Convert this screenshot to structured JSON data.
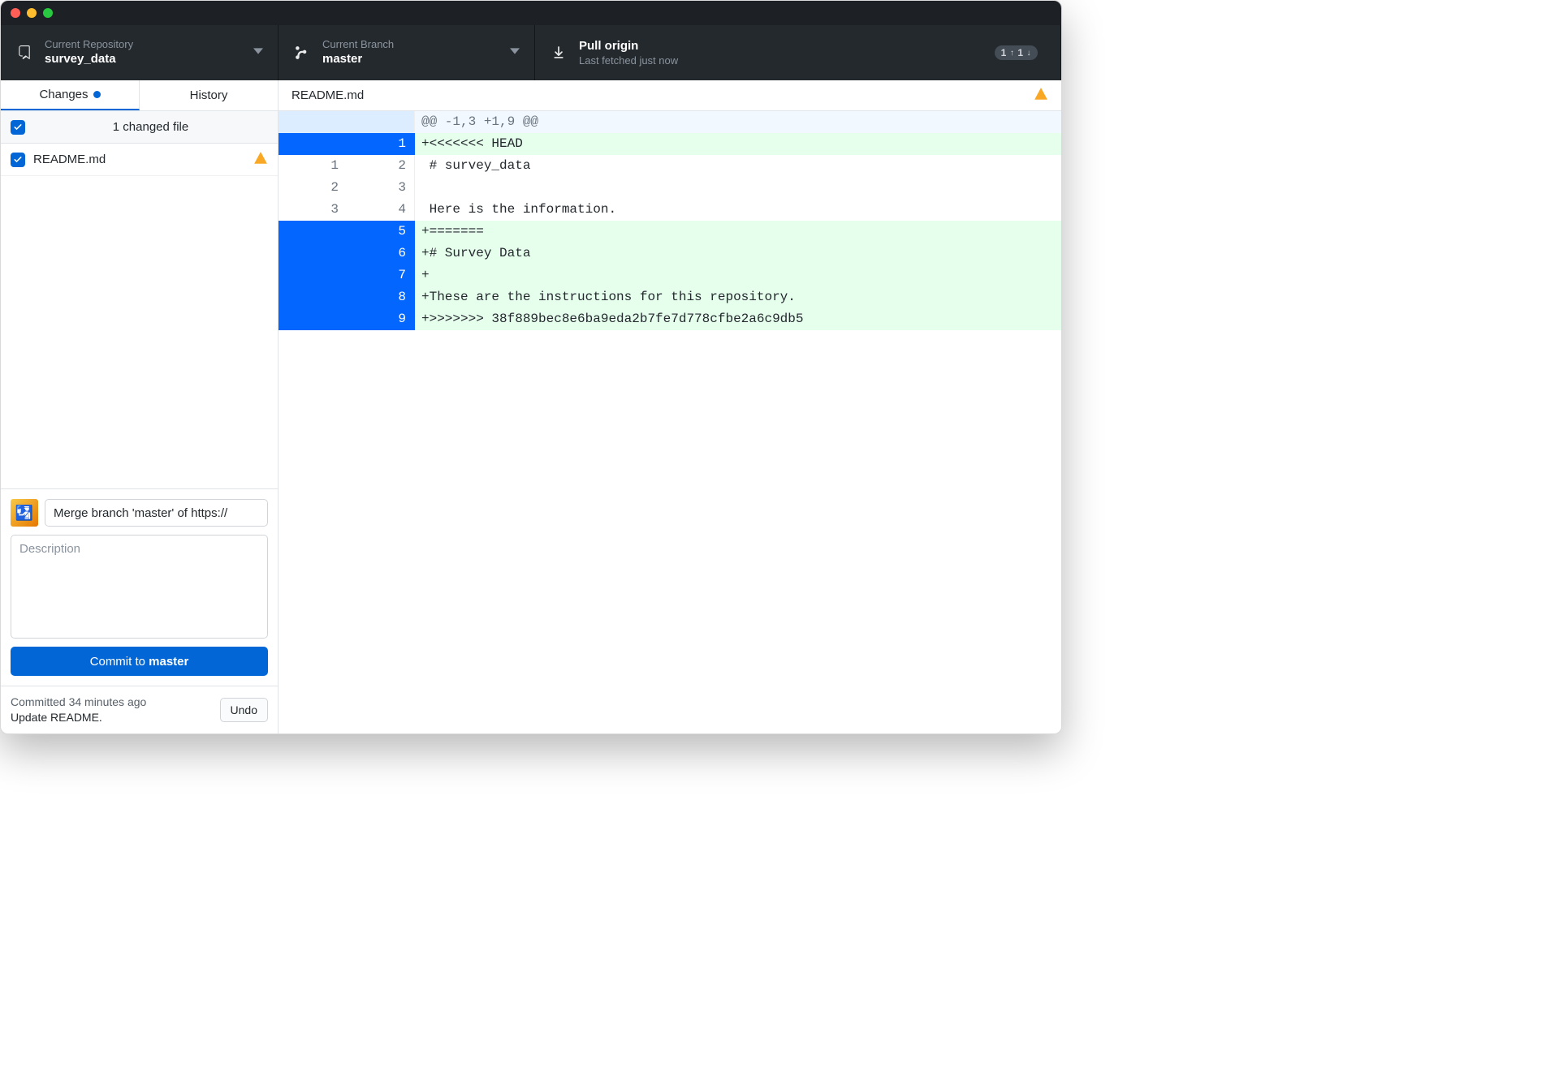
{
  "toolbar": {
    "repo": {
      "label": "Current Repository",
      "value": "survey_data"
    },
    "branch": {
      "label": "Current Branch",
      "value": "master"
    },
    "pull": {
      "label": "Pull origin",
      "sub": "Last fetched just now",
      "badge_up": "1",
      "badge_down": "1"
    }
  },
  "sidebar": {
    "tabs": {
      "changes": "Changes",
      "history": "History"
    },
    "summary": "1 changed file",
    "file": "README.md",
    "commit_summary_value": "Merge branch 'master' of https://",
    "desc_placeholder": "Description",
    "commit_btn_prefix": "Commit to ",
    "commit_btn_branch": "master",
    "undo_time": "Committed 34 minutes ago",
    "undo_title": "Update README.",
    "undo_label": "Undo"
  },
  "diff": {
    "file": "README.md",
    "lines": [
      {
        "kind": "hunk",
        "old": "",
        "new": "",
        "text": "@@ -1,3 +1,9 @@"
      },
      {
        "kind": "add-sel",
        "old": "",
        "new": "1",
        "text": "+<<<<<<< HEAD"
      },
      {
        "kind": "ctx",
        "old": "1",
        "new": "2",
        "text": " # survey_data"
      },
      {
        "kind": "ctx",
        "old": "2",
        "new": "3",
        "text": " "
      },
      {
        "kind": "ctx",
        "old": "3",
        "new": "4",
        "text": " Here is the information."
      },
      {
        "kind": "add-sel",
        "old": "",
        "new": "5",
        "text": "+======="
      },
      {
        "kind": "add-sel",
        "old": "",
        "new": "6",
        "text": "+# Survey Data"
      },
      {
        "kind": "add-sel",
        "old": "",
        "new": "7",
        "text": "+"
      },
      {
        "kind": "add-sel",
        "old": "",
        "new": "8",
        "text": "+These are the instructions for this repository."
      },
      {
        "kind": "add-sel",
        "old": "",
        "new": "9",
        "text": "+>>>>>>> 38f889bec8e6ba9eda2b7fe7d778cfbe2a6c9db5"
      }
    ]
  }
}
